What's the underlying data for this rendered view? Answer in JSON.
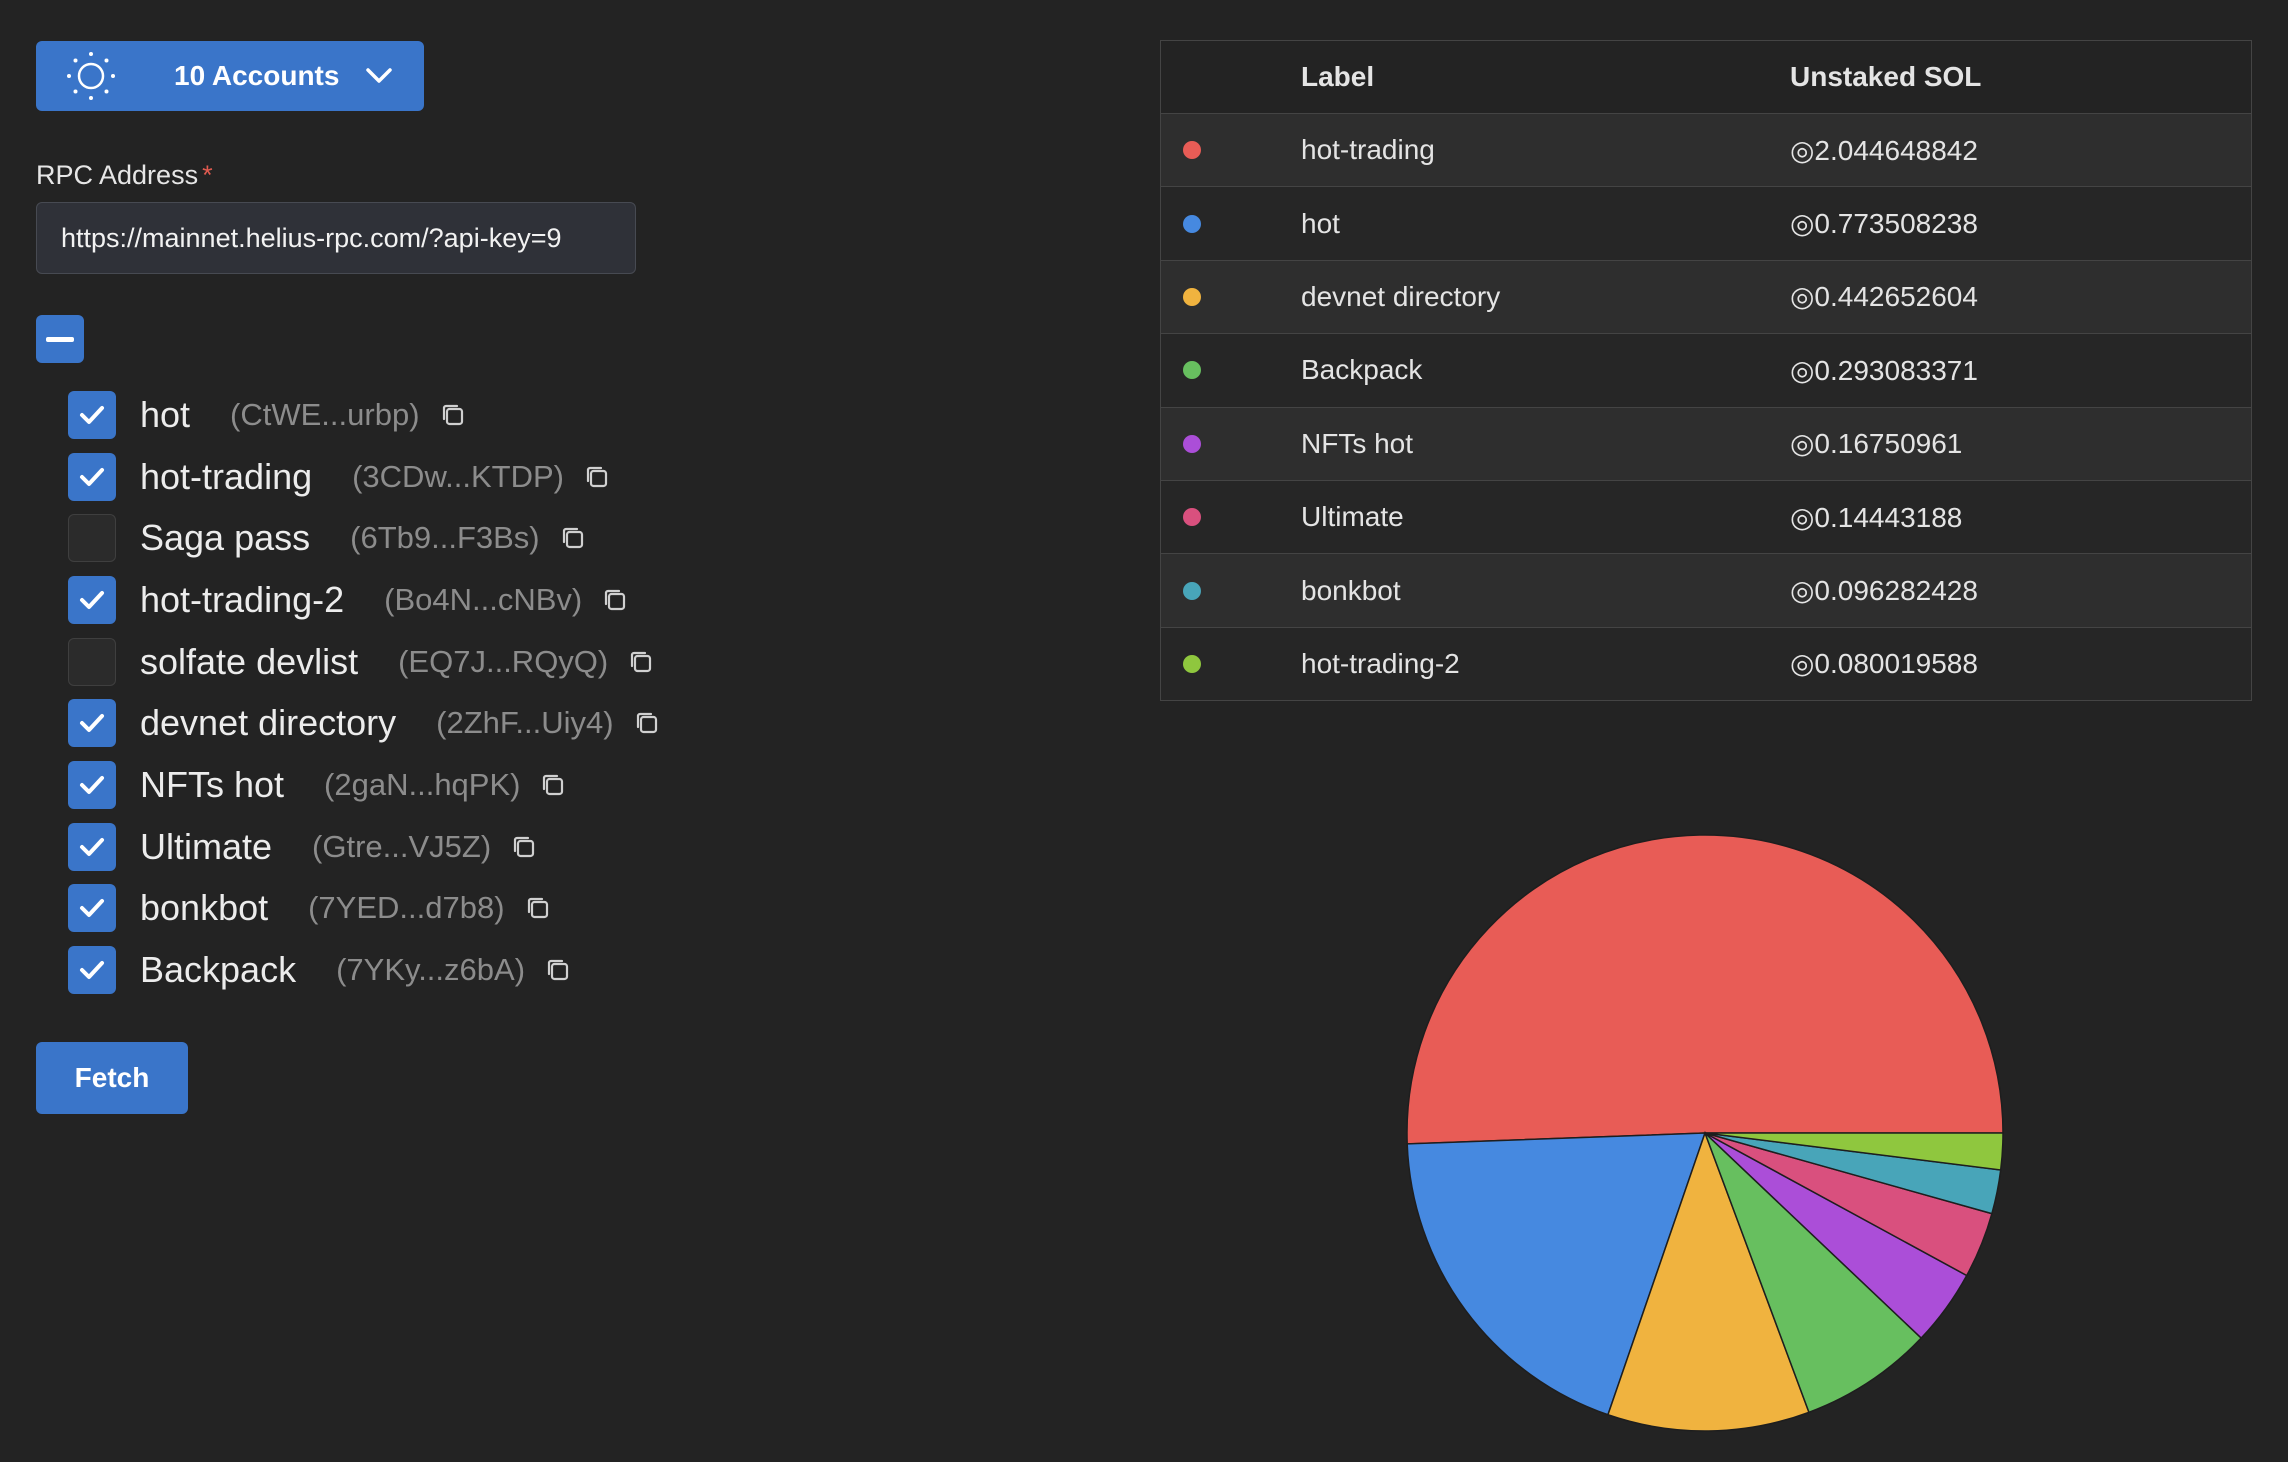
{
  "account_selector": {
    "label": "10 Accounts",
    "icon": "solana-sun-icon"
  },
  "rpc": {
    "label": "RPC Address",
    "required_mark": "*",
    "value": "https://mainnet.helius-rpc.com/?api-key=9"
  },
  "accounts": [
    {
      "name": "hot",
      "address": "(CtWE...urbp)",
      "checked": true
    },
    {
      "name": "hot-trading",
      "address": "(3CDw...KTDP)",
      "checked": true
    },
    {
      "name": "Saga pass",
      "address": "(6Tb9...F3Bs)",
      "checked": false
    },
    {
      "name": "hot-trading-2",
      "address": "(Bo4N...cNBv)",
      "checked": true
    },
    {
      "name": "solfate devlist",
      "address": "(EQ7J...RQyQ)",
      "checked": false
    },
    {
      "name": "devnet directory",
      "address": "(2ZhF...Uiy4)",
      "checked": true
    },
    {
      "name": "NFTs hot",
      "address": "(2gaN...hqPK)",
      "checked": true
    },
    {
      "name": "Ultimate",
      "address": "(Gtre...VJ5Z)",
      "checked": true
    },
    {
      "name": "bonkbot",
      "address": "(7YED...d7b8)",
      "checked": true
    },
    {
      "name": "Backpack",
      "address": "(7YKy...z6bA)",
      "checked": true
    }
  ],
  "fetch_label": "Fetch",
  "table": {
    "headers": [
      "",
      "Label",
      "Unstaked SOL"
    ],
    "rows": [
      {
        "label": "hot-trading",
        "value": "◎2.044648842",
        "color": "#e85c56"
      },
      {
        "label": "hot",
        "value": "◎0.773508238",
        "color": "#4689e0"
      },
      {
        "label": "devnet directory",
        "value": "◎0.442652604",
        "color": "#f0b33f"
      },
      {
        "label": "Backpack",
        "value": "◎0.293083371",
        "color": "#67bf5f"
      },
      {
        "label": "NFTs hot",
        "value": "◎0.16750961",
        "color": "#ab4ed8"
      },
      {
        "label": "Ultimate",
        "value": "◎0.14443188",
        "color": "#d9507e"
      },
      {
        "label": "bonkbot",
        "value": "◎0.096282428",
        "color": "#48a5b9"
      },
      {
        "label": "hot-trading-2",
        "value": "◎0.080019588",
        "color": "#8fc73e"
      }
    ]
  },
  "chart_data": {
    "type": "pie",
    "categories": [
      "hot-trading",
      "hot",
      "devnet directory",
      "Backpack",
      "NFTs hot",
      "Ultimate",
      "bonkbot",
      "hot-trading-2"
    ],
    "values": [
      2.044648842,
      0.773508238,
      0.442652604,
      0.293083371,
      0.16750961,
      0.14443188,
      0.096282428,
      0.080019588
    ],
    "colors": [
      "#e85c56",
      "#4689e0",
      "#f0b33f",
      "#67bf5f",
      "#ab4ed8",
      "#d9507e",
      "#48a5b9",
      "#8fc73e"
    ],
    "title": ""
  }
}
